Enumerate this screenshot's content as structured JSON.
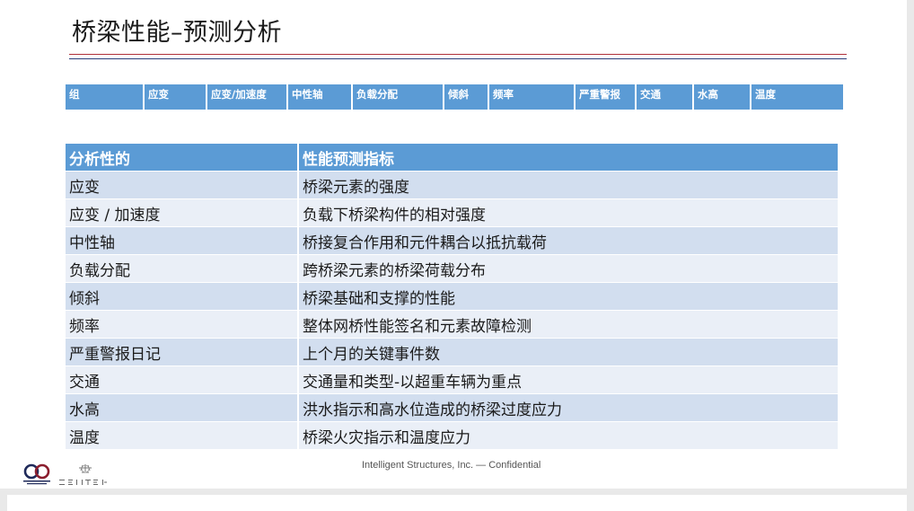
{
  "title": "桥梁性能–预测分析",
  "header_strip": [
    "组",
    "应变",
    "应变/加速度",
    "中性轴",
    "负载分配",
    "倾斜",
    "频率",
    "严重警报",
    "交通",
    "水高",
    "温度"
  ],
  "table": {
    "headers": [
      "分析性的",
      "性能预测指标"
    ],
    "rows": [
      [
        "应变",
        "桥梁元素的强度"
      ],
      [
        "应变 / 加速度",
        "负载下桥梁构件的相对强度"
      ],
      [
        "中性轴",
        "桥接复合作用和元件耦合以抵抗载荷"
      ],
      [
        "负载分配",
        "跨桥梁元素的桥梁荷载分布"
      ],
      [
        "倾斜",
        "桥梁基础和支撑的性能"
      ],
      [
        "频率",
        "整体网桥性能签名和元素故障检测"
      ],
      [
        "严重警报日记",
        "上个月的关键事件数"
      ],
      [
        "交通",
        "交通量和类型-以超重车辆为重点"
      ],
      [
        "水高",
        "洪水指示和高水位造成的桥梁过度应力"
      ],
      [
        "温度",
        "桥梁火灾指示和温度应力"
      ]
    ]
  },
  "footer": "Intelligent Structures, Inc.  —  Confidential",
  "logos": [
    "intelligent-structures-logo",
    "zentek-logo"
  ],
  "colors": {
    "header_blue": "#5b9bd5",
    "row_dark": "#d2deef",
    "row_light": "#eaeff7",
    "rule_red": "#b0303a",
    "rule_blue": "#2a3d7a"
  }
}
